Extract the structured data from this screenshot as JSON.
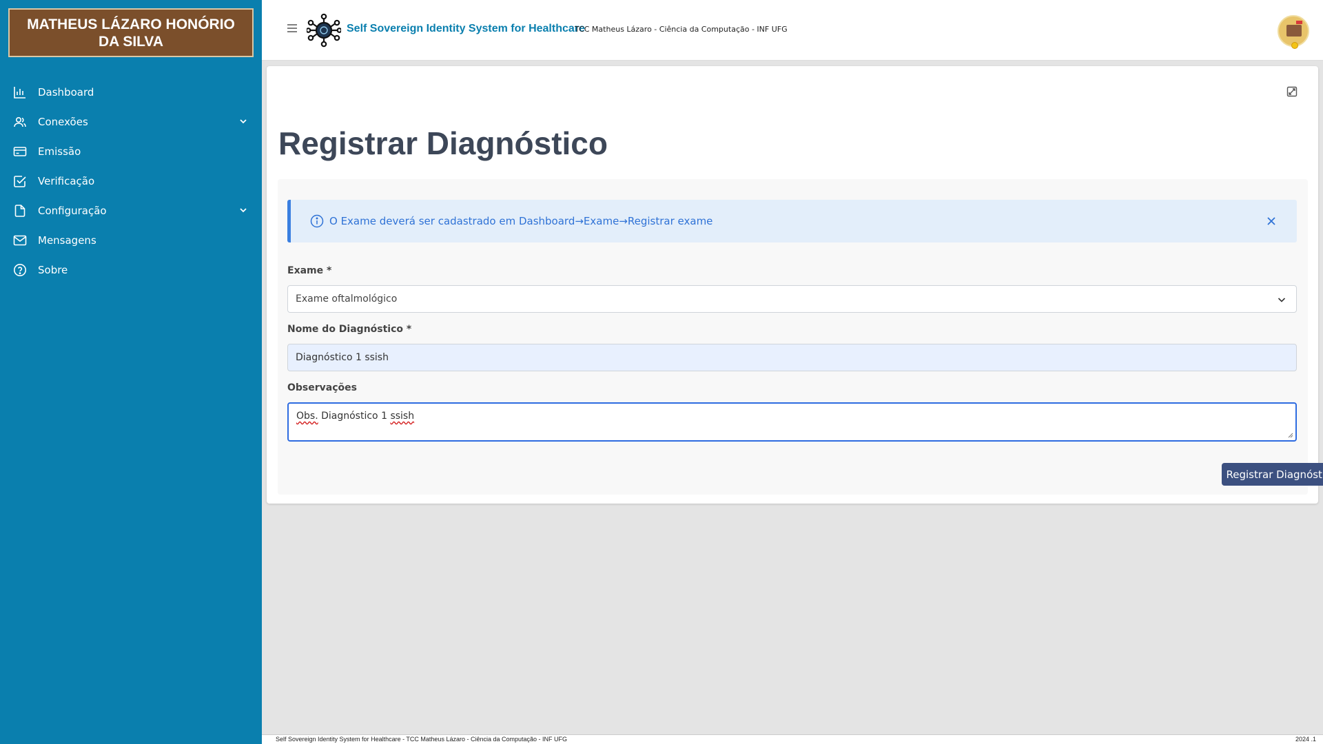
{
  "sidebar": {
    "brand": "MATHEUS LÁZARO HONÓRIO DA SILVA",
    "items": [
      {
        "label": "Dashboard",
        "icon": "bar-chart-icon",
        "expandable": false
      },
      {
        "label": "Conexões",
        "icon": "users-icon",
        "expandable": true
      },
      {
        "label": "Emissão",
        "icon": "credit-card-icon",
        "expandable": false
      },
      {
        "label": "Verificação",
        "icon": "check-square-icon",
        "expandable": false
      },
      {
        "label": "Configuração",
        "icon": "file-icon",
        "expandable": true
      },
      {
        "label": "Mensagens",
        "icon": "mail-icon",
        "expandable": false
      },
      {
        "label": "Sobre",
        "icon": "help-circle-icon",
        "expandable": false
      }
    ]
  },
  "header": {
    "title": "Self Sovereign Identity System for Healthcare",
    "subtitle": "TCC Matheus Lázaro - Ciência da Computação - INF UFG"
  },
  "page": {
    "title": "Registrar Diagnóstico"
  },
  "alert": {
    "text": "O Exame deverá ser cadastrado em Dashboard→Exame→Registrar exame"
  },
  "form": {
    "exame_label": "Exame *",
    "exame_value": "Exame oftalmológico",
    "nome_label": "Nome do Diagnóstico *",
    "nome_value": "Diagnóstico 1 ssish",
    "obs_label": "Observações",
    "obs_value_parts": [
      "Obs.",
      " Diagnóstico 1 ",
      "ssish"
    ],
    "submit_label": "Registrar Diagnóstico"
  },
  "footer": {
    "left": "Self Sovereign Identity System for Healthcare - TCC Matheus Lázaro - Ciência da Computação - INF UFG",
    "right": "2024 .1"
  },
  "colors": {
    "sidebar_bg": "#0a7fae",
    "brand_bg": "#7b4f2b",
    "accent": "#0a7fae",
    "button_bg": "#3c5080",
    "alert_text": "#2f72d6"
  }
}
